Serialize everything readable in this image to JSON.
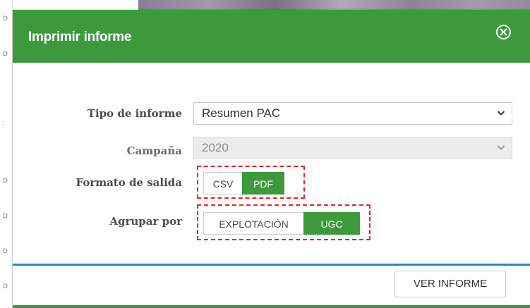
{
  "background": {
    "left_marks": [
      "D",
      "D",
      ";",
      "D",
      "D",
      "D",
      "D"
    ]
  },
  "modal": {
    "title": "Imprimir informe",
    "close_icon": "close-circle-icon",
    "accent_color": "#3c9a3c",
    "footer_rule_color": "#2f86c8"
  },
  "form": {
    "tipo_informe": {
      "label": "Tipo de informe",
      "value": "Resumen PAC"
    },
    "campana": {
      "label": "Campaña",
      "value": "2020",
      "disabled": true
    },
    "formato_salida": {
      "label": "Formato de salida",
      "options": [
        {
          "label": "CSV",
          "selected": false
        },
        {
          "label": "PDF",
          "selected": true
        }
      ]
    },
    "agrupar_por": {
      "label": "Agrupar por",
      "options": [
        {
          "label": "EXPLOTACIÓN",
          "selected": false
        },
        {
          "label": "UGC",
          "selected": true
        }
      ]
    }
  },
  "footer": {
    "submit_label": "VER INFORME"
  }
}
